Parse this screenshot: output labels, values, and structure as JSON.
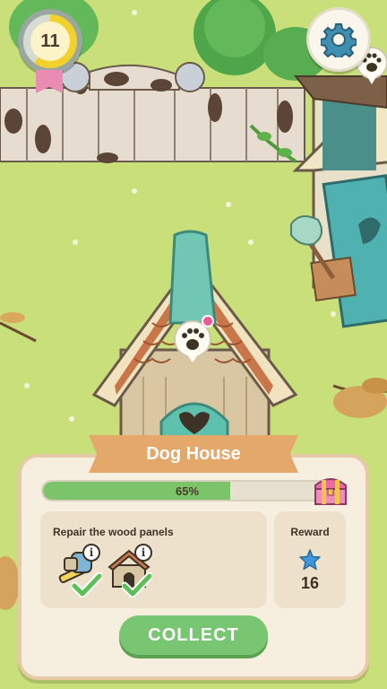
{
  "hud": {
    "level": "11",
    "level_progress": 0.6
  },
  "building": {
    "name": "Dog House"
  },
  "panel": {
    "progress": {
      "percent": 65,
      "label": "65%"
    },
    "task": {
      "description": "Repair the wood panels",
      "items": [
        {
          "icon": "hammer-tool-icon",
          "completed": true
        },
        {
          "icon": "doghouse-icon",
          "completed": true
        }
      ]
    },
    "reward": {
      "label": "Reward",
      "icon": "blue-star-icon",
      "value": "16"
    },
    "collect_label": "COLLECT"
  },
  "colors": {
    "progress_fill": "#7bc46a",
    "collect_button": "#79c672",
    "banner": "#e3a86a",
    "grass": "#c9e07a",
    "roof_trim": "#6fbfae"
  }
}
